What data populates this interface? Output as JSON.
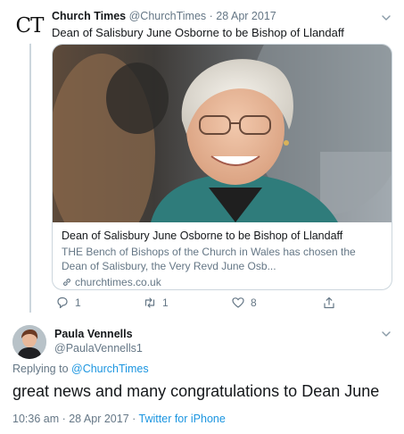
{
  "parent_tweet": {
    "avatar_text": "CT",
    "author_name": "Church Times",
    "author_handle": "@ChurchTimes",
    "separator": " · ",
    "date": "28 Apr 2017",
    "text": "Dean of Salisbury June Osborne to be Bishop of Llandaff",
    "card": {
      "title": "Dean of Salisbury June Osborne to be Bishop of Llandaff",
      "description": "THE Bench of Bishops of the Church in Wales has chosen the Dean of Salisbury, the Very Revd June Osb...",
      "domain": "churchtimes.co.uk"
    },
    "actions": {
      "replies": "1",
      "retweets": "1",
      "likes": "8"
    }
  },
  "reply_tweet": {
    "author_name": "Paula Vennells",
    "author_handle": "@PaulaVennells1",
    "replying_prefix": "Replying to ",
    "replying_to": "@ChurchTimes",
    "text": "great news and many congratulations to Dean June",
    "time": "10:36 am",
    "separator": " · ",
    "date": "28 Apr 2017",
    "separator2": " · ",
    "source": "Twitter for iPhone"
  },
  "colors": {
    "link": "#1b95e0",
    "secondary_text": "#657786",
    "border": "#ccd6dd"
  },
  "icons": [
    "chevron-down-icon",
    "reply-icon",
    "retweet-icon",
    "like-icon",
    "share-icon",
    "link-icon"
  ]
}
